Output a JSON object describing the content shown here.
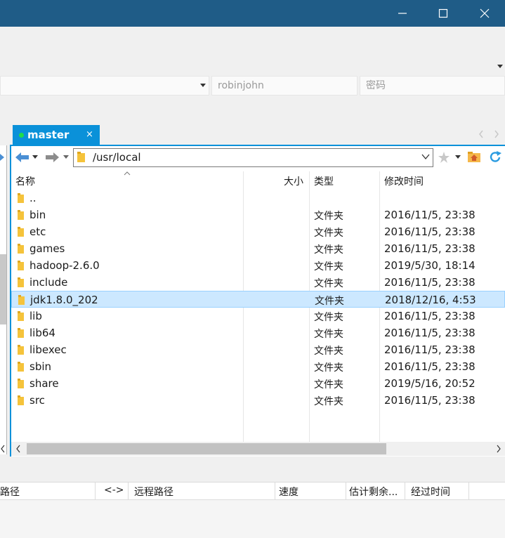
{
  "window": {
    "minimize_label": "minimize",
    "maximize_label": "maximize",
    "close_label": "close"
  },
  "login": {
    "username": "robinjohn",
    "password_placeholder": "密码"
  },
  "tab": {
    "label": "master",
    "close": "×"
  },
  "nav": {
    "path": "/usr/local"
  },
  "columns": {
    "name": "名称",
    "size": "大小",
    "type": "类型",
    "modified": "修改时间"
  },
  "files": [
    {
      "name": "..",
      "type": "",
      "modified": ""
    },
    {
      "name": "bin",
      "type": "文件夹",
      "modified": "2016/11/5, 23:38"
    },
    {
      "name": "etc",
      "type": "文件夹",
      "modified": "2016/11/5, 23:38"
    },
    {
      "name": "games",
      "type": "文件夹",
      "modified": "2016/11/5, 23:38"
    },
    {
      "name": "hadoop-2.6.0",
      "type": "文件夹",
      "modified": "2019/5/30, 18:14"
    },
    {
      "name": "include",
      "type": "文件夹",
      "modified": "2016/11/5, 23:38"
    },
    {
      "name": "jdk1.8.0_202",
      "type": "文件夹",
      "modified": "2018/12/16, 4:53",
      "selected": true
    },
    {
      "name": "lib",
      "type": "文件夹",
      "modified": "2016/11/5, 23:38"
    },
    {
      "name": "lib64",
      "type": "文件夹",
      "modified": "2016/11/5, 23:38"
    },
    {
      "name": "libexec",
      "type": "文件夹",
      "modified": "2016/11/5, 23:38"
    },
    {
      "name": "sbin",
      "type": "文件夹",
      "modified": "2016/11/5, 23:38"
    },
    {
      "name": "share",
      "type": "文件夹",
      "modified": "2019/5/16, 20:52"
    },
    {
      "name": "src",
      "type": "文件夹",
      "modified": "2016/11/5, 23:38"
    }
  ],
  "transfer": {
    "local_path": "路径",
    "direction": "<->",
    "remote_path": "远程路径",
    "speed": "速度",
    "remaining": "估计剩余...",
    "elapsed": "经过时间"
  },
  "colors": {
    "titlebar": "#1f5c87",
    "accent": "#0a91d9",
    "selection": "#cce8ff",
    "folder": "#f5c33b"
  },
  "icons": [
    "minimize-icon",
    "maximize-icon",
    "close-icon",
    "dropdown-icon",
    "back-arrow-icon",
    "forward-arrow-icon",
    "folder-icon",
    "star-icon",
    "folder-home-icon",
    "refresh-icon",
    "sort-up-icon",
    "scroll-left-icon",
    "scroll-right-icon",
    "scroll-arrows-icon"
  ]
}
